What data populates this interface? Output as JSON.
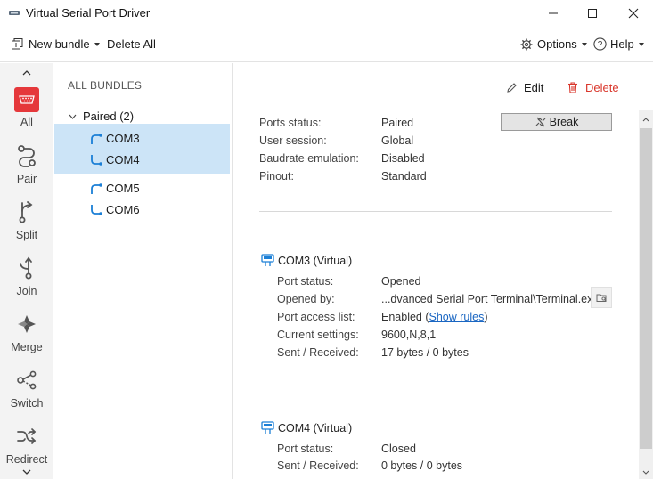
{
  "window": {
    "title": "Virtual Serial Port Driver",
    "icon": "app-connector-icon"
  },
  "toolbar": {
    "new_bundle": "New bundle",
    "delete_all": "Delete All",
    "options": "Options",
    "help": "Help"
  },
  "rail": {
    "items": [
      {
        "label": "All",
        "icon": "serial-port-icon"
      },
      {
        "label": "Pair",
        "icon": "pair-icon"
      },
      {
        "label": "Split",
        "icon": "split-icon"
      },
      {
        "label": "Join",
        "icon": "join-icon"
      },
      {
        "label": "Merge",
        "icon": "merge-icon"
      },
      {
        "label": "Switch",
        "icon": "switch-icon"
      },
      {
        "label": "Redirect",
        "icon": "redirect-icon"
      }
    ],
    "accent": "#e5383b"
  },
  "bundles": {
    "header": "ALL BUNDLES",
    "group_label": "Paired (2)",
    "pairs": [
      {
        "a": "COM3",
        "b": "COM4"
      },
      {
        "a": "COM5",
        "b": "COM6"
      }
    ]
  },
  "details": {
    "edit_label": "Edit",
    "delete_label": "Delete",
    "break_label": "Break",
    "summary": [
      {
        "label": "Ports status:",
        "value": "Paired"
      },
      {
        "label": "User session:",
        "value": "Global"
      },
      {
        "label": "Baudrate emulation:",
        "value": "Disabled"
      },
      {
        "label": "Pinout:",
        "value": "Standard"
      }
    ],
    "com3": {
      "title": "COM3 (Virtual)",
      "rows": [
        {
          "label": "Port status:",
          "value": "Opened"
        },
        {
          "label": "Opened by:",
          "value": "...dvanced Serial Port Terminal\\Terminal.exe"
        },
        {
          "label": "Port access list:",
          "value": "Enabled (",
          "link": "Show rules",
          "tail": ")"
        },
        {
          "label": "Current settings:",
          "value": "9600,N,8,1"
        },
        {
          "label": "Sent / Received:",
          "value": "17 bytes / 0 bytes"
        }
      ]
    },
    "com4": {
      "title": "COM4 (Virtual)",
      "rows": [
        {
          "label": "Port status:",
          "value": "Closed"
        },
        {
          "label": "Sent / Received:",
          "value": "0 bytes / 0 bytes"
        }
      ]
    }
  },
  "colors": {
    "selection": "#cce4f7",
    "link": "#1a66c2",
    "delete": "#d9362b",
    "port_icon": "#1b7fd6"
  }
}
